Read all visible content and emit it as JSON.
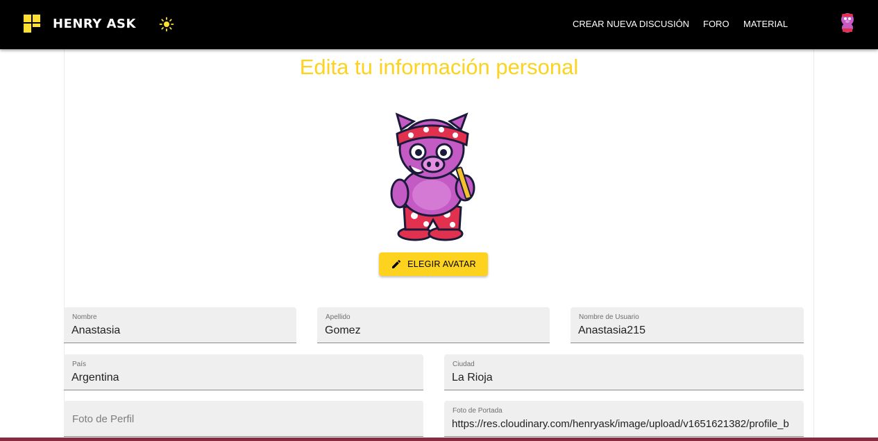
{
  "navbar": {
    "brand": "HENRY ASK",
    "links": [
      "CREAR NUEVA DISCUSIÓN",
      "FORO",
      "MATERIAL"
    ],
    "theme_icon": "sun-icon",
    "accent": "#fdd31f"
  },
  "page": {
    "title": "Edita tu información personal",
    "choose_avatar_label": "ELEGIR AVATAR"
  },
  "form": {
    "nombre": {
      "label": "Nombre",
      "value": "Anastasia"
    },
    "apellido": {
      "label": "Apellido",
      "value": "Gomez"
    },
    "usuario": {
      "label": "Nombre de Usuario",
      "value": "Anastasia215"
    },
    "pais": {
      "label": "País",
      "value": "Argentina"
    },
    "ciudad": {
      "label": "Ciudad",
      "value": "La Rioja"
    },
    "foto_perfil": {
      "placeholder": "Foto de Perfil"
    },
    "foto_portada": {
      "label": "Foto de Portada",
      "value": "https://res.cloudinary.com/henryask/image/upload/v1651621382/profile_b"
    }
  }
}
